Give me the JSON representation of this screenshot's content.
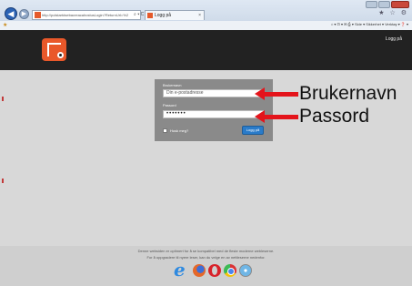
{
  "browser": {
    "address_url": "http://polstartdsebacreacalrostusLogin?ReturnUrl=%2",
    "address_tools": "⌕ ▾ C",
    "tab_title": "Logg på",
    "tab_close": "×",
    "toolbar_right": "★ ☆ ⚙",
    "command_bar": "⌂ ▾  ⊡ ▾  ✉  ⎙ ▾  Side ▾  Sikkerhet ▾  Verktøy ▾  ❓ ▾"
  },
  "header": {
    "login_link": "Logg på"
  },
  "login_form": {
    "username_label": "Brukernavn",
    "username_placeholder": "Din e-postadresse",
    "password_label": "Passord",
    "password_value": "•••••••",
    "remember_label": "Husk meg?",
    "submit_label": "Logg på"
  },
  "annotations": {
    "username": "Brukernavn",
    "password": "Passord"
  },
  "footer": {
    "line1": "Denne websiden er optimert for å se kompatibel med de fleste moderne webleserne.",
    "line2": "For å oppgradere til nyere leser, kan du velge en av nettleserne nedenfor.",
    "browsers": [
      "internet-explorer",
      "firefox",
      "opera",
      "chrome",
      "safari"
    ]
  },
  "colors": {
    "accent": "#e9582a",
    "button": "#2a7bc9",
    "arrow": "#e4141b"
  }
}
